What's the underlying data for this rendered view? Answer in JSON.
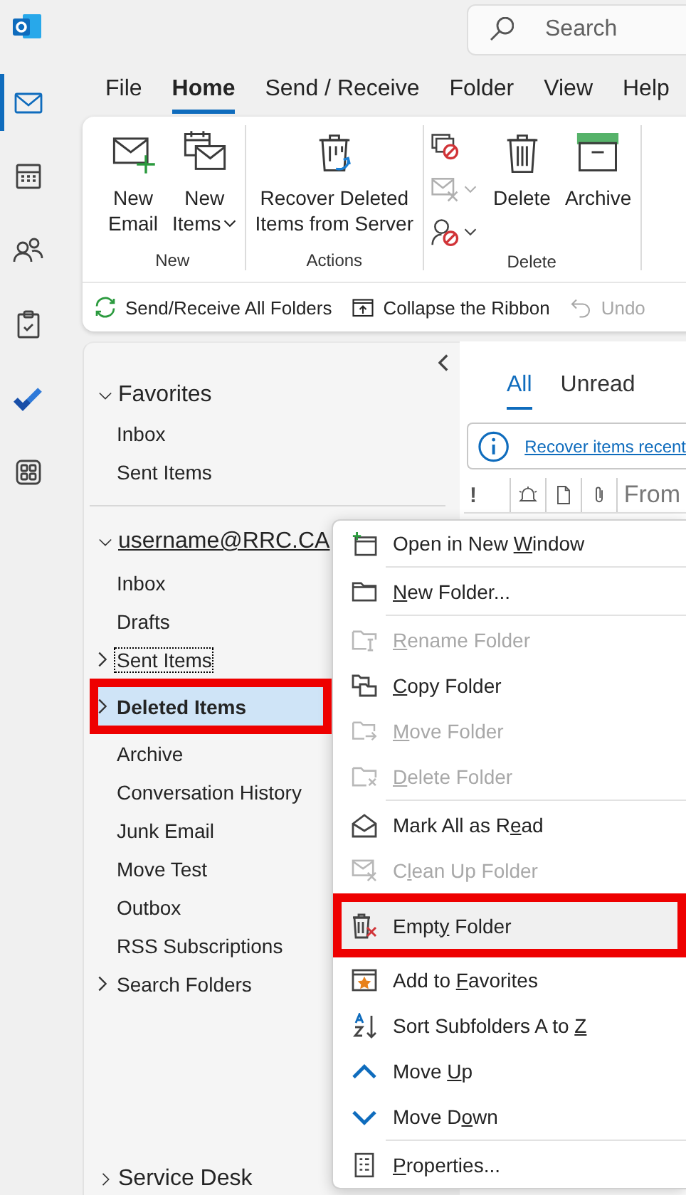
{
  "rail": [
    {
      "kind": "mail",
      "selected": true
    },
    {
      "kind": "calendar",
      "selected": false
    },
    {
      "kind": "people",
      "selected": false
    },
    {
      "kind": "tasks",
      "selected": false
    },
    {
      "kind": "todo",
      "selected": false
    },
    {
      "kind": "apps",
      "selected": false
    }
  ],
  "search": {
    "placeholder": "Search"
  },
  "ribbon_tabs": [
    {
      "label": "File",
      "selected": false
    },
    {
      "label": "Home",
      "selected": true
    },
    {
      "label": "Send / Receive",
      "selected": false
    },
    {
      "label": "Folder",
      "selected": false
    },
    {
      "label": "View",
      "selected": false
    },
    {
      "label": "Help",
      "selected": false
    }
  ],
  "ribbon_groups": [
    {
      "label": "New",
      "buttons": [
        {
          "kind": "new-email",
          "lines": [
            "New",
            "Email"
          ],
          "dropdown": false
        },
        {
          "kind": "new-items",
          "lines": [
            "New",
            "Items"
          ],
          "dropdown": true
        }
      ]
    },
    {
      "label": "Actions",
      "buttons": [
        {
          "kind": "recover",
          "lines": [
            "Recover Deleted",
            "Items from Server"
          ],
          "dropdown": false
        }
      ]
    },
    {
      "label": "Delete",
      "small_buttons": [
        {
          "kind": "ignore",
          "disabled": false,
          "dropdown": false
        },
        {
          "kind": "cleanup",
          "disabled": true,
          "dropdown": true
        },
        {
          "kind": "junk",
          "disabled": false,
          "dropdown": true
        }
      ],
      "buttons": [
        {
          "kind": "delete",
          "lines": [
            "Delete"
          ],
          "dropdown": false
        },
        {
          "kind": "archive",
          "lines": [
            "Archive"
          ],
          "dropdown": false
        }
      ]
    }
  ],
  "quick_access": [
    {
      "kind": "sync",
      "label": "Send/Receive All Folders",
      "disabled": false
    },
    {
      "kind": "collapse",
      "label": "Collapse the Ribbon",
      "disabled": false
    },
    {
      "kind": "undo",
      "label": "Undo",
      "disabled": true
    }
  ],
  "folder_pane": {
    "favorites": {
      "label": "Favorites",
      "expanded": true,
      "folders": [
        {
          "label": "Inbox",
          "selected": false
        },
        {
          "label": "Sent Items",
          "selected": false
        }
      ]
    },
    "account": {
      "label": "username@RRC.CA",
      "expanded": true,
      "folders": [
        {
          "label": "Inbox",
          "selected": false,
          "has_children": false,
          "focused": false,
          "annotated": false
        },
        {
          "label": "Drafts",
          "selected": false,
          "has_children": false,
          "focused": false,
          "annotated": false
        },
        {
          "label": "Sent Items",
          "selected": false,
          "has_children": true,
          "focused": true,
          "annotated": false
        },
        {
          "label": "Deleted Items",
          "selected": true,
          "has_children": true,
          "focused": false,
          "annotated": true
        },
        {
          "label": "Archive",
          "selected": false,
          "has_children": false,
          "focused": false,
          "annotated": false
        },
        {
          "label": "Conversation History",
          "selected": false,
          "has_children": false,
          "focused": false,
          "annotated": false
        },
        {
          "label": "Junk Email",
          "selected": false,
          "has_children": false,
          "focused": false,
          "annotated": false
        },
        {
          "label": "Move Test",
          "selected": false,
          "has_children": false,
          "focused": false,
          "annotated": false
        },
        {
          "label": "Outbox",
          "selected": false,
          "has_children": false,
          "focused": false,
          "annotated": false
        },
        {
          "label": "RSS Subscriptions",
          "selected": false,
          "has_children": false,
          "focused": false,
          "annotated": false
        },
        {
          "label": "Search Folders",
          "selected": false,
          "has_children": true,
          "focused": false,
          "annotated": false
        }
      ]
    },
    "other_groups": [
      {
        "label": "Service Desk",
        "expanded": false
      }
    ]
  },
  "message_list": {
    "filters": [
      {
        "label": "All",
        "selected": true
      },
      {
        "label": "Unread",
        "selected": false
      }
    ],
    "info_link": "Recover items recent",
    "columns": [
      {
        "kind": "importance",
        "label": "!"
      },
      {
        "kind": "reminder"
      },
      {
        "kind": "type"
      },
      {
        "kind": "attachment"
      },
      {
        "kind": "text",
        "label": "From"
      }
    ]
  },
  "context_menu": [
    {
      "kind": "open-window",
      "label": {
        "before": "Open in New ",
        "key": "W",
        "after": "indow"
      },
      "disabled": false,
      "hovered": false,
      "annotated": false
    },
    {
      "kind": "separator"
    },
    {
      "kind": "new-folder",
      "label": {
        "key": "N",
        "after": "ew Folder..."
      },
      "disabled": false,
      "hovered": false,
      "annotated": false
    },
    {
      "kind": "separator"
    },
    {
      "kind": "rename",
      "label": {
        "key": "R",
        "after": "ename Folder"
      },
      "disabled": true,
      "hovered": false,
      "annotated": false
    },
    {
      "kind": "copy",
      "label": {
        "key": "C",
        "after": "opy Folder"
      },
      "disabled": false,
      "hovered": false,
      "annotated": false
    },
    {
      "kind": "move",
      "label": {
        "key": "M",
        "after": "ove Folder"
      },
      "disabled": true,
      "hovered": false,
      "annotated": false
    },
    {
      "kind": "delete-folder",
      "label": {
        "key": "D",
        "after": "elete Folder"
      },
      "disabled": true,
      "hovered": false,
      "annotated": false
    },
    {
      "kind": "separator"
    },
    {
      "kind": "mark-read",
      "label": {
        "before": "Mark All as R",
        "key": "e",
        "after": "ad"
      },
      "disabled": false,
      "hovered": false,
      "annotated": false
    },
    {
      "kind": "cleanup",
      "label": {
        "before": "C",
        "key": "l",
        "after": "ean Up Folder"
      },
      "disabled": true,
      "hovered": false,
      "annotated": false
    },
    {
      "kind": "empty",
      "label": {
        "before": "Empt",
        "key": "y",
        "after": " Folder"
      },
      "disabled": false,
      "hovered": true,
      "annotated": true
    },
    {
      "kind": "favorite",
      "label": {
        "before": "Add to ",
        "key": "F",
        "after": "avorites"
      },
      "disabled": false,
      "hovered": false,
      "annotated": false
    },
    {
      "kind": "sort",
      "label": {
        "before": "Sort Subfolders A to ",
        "key": "Z"
      },
      "disabled": false,
      "hovered": false,
      "annotated": false
    },
    {
      "kind": "up",
      "label": {
        "before": "Move ",
        "key": "U",
        "after": "p"
      },
      "disabled": false,
      "hovered": false,
      "annotated": false
    },
    {
      "kind": "down",
      "label": {
        "before": "Move D",
        "key": "o",
        "after": "wn"
      },
      "disabled": false,
      "hovered": false,
      "annotated": false
    },
    {
      "kind": "separator"
    },
    {
      "kind": "properties",
      "label": {
        "key": "P",
        "after": "roperties..."
      },
      "disabled": false,
      "hovered": false,
      "annotated": false
    }
  ]
}
